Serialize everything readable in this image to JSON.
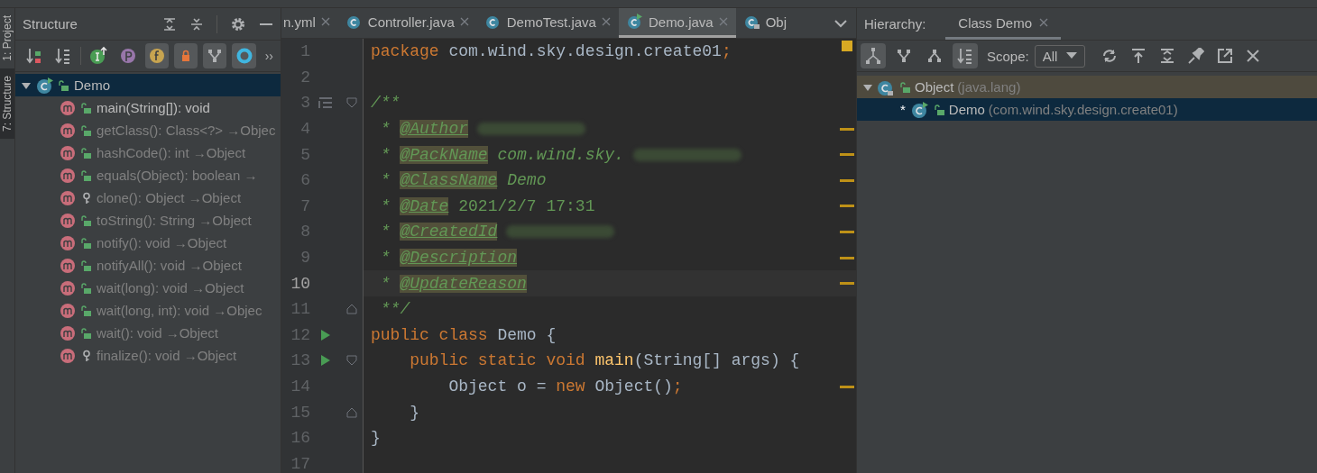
{
  "side_tabs": [
    {
      "label": "1: Project",
      "selected": false
    },
    {
      "label": "7: Structure",
      "selected": true
    }
  ],
  "structure": {
    "title": "Structure",
    "toolbar": [
      {
        "pressed": false
      },
      {
        "pressed": false
      },
      {
        "pressed": false
      },
      {
        "pressed": false
      },
      {
        "pressed": true
      },
      {
        "pressed": true
      },
      {
        "pressed": true
      },
      {
        "pressed": true
      }
    ],
    "more": "››",
    "root": {
      "label": "Demo",
      "expanded": true,
      "selected": true
    },
    "items": [
      {
        "label": "main(String[]): void",
        "kind": "public",
        "inherited": false
      },
      {
        "label": "getClass(): Class<?> →Objec",
        "kind": "public",
        "inherited": true
      },
      {
        "label": "hashCode(): int →Object",
        "kind": "public",
        "inherited": true
      },
      {
        "label": "equals(Object): boolean →",
        "kind": "public",
        "inherited": true
      },
      {
        "label": "clone(): Object →Object",
        "kind": "protected",
        "inherited": true
      },
      {
        "label": "toString(): String →Object",
        "kind": "public",
        "inherited": true
      },
      {
        "label": "notify(): void →Object",
        "kind": "public",
        "inherited": true
      },
      {
        "label": "notifyAll(): void →Object",
        "kind": "public",
        "inherited": true
      },
      {
        "label": "wait(long): void →Object",
        "kind": "public",
        "inherited": true
      },
      {
        "label": "wait(long, int): void →Objec",
        "kind": "public",
        "inherited": true
      },
      {
        "label": "wait(): void →Object",
        "kind": "public",
        "inherited": true
      },
      {
        "label": "finalize(): void →Object",
        "kind": "protected",
        "inherited": true
      }
    ]
  },
  "editor": {
    "tabs": [
      {
        "label": "n.yml",
        "kind": "file",
        "selected": false,
        "closable": true
      },
      {
        "label": "Controller.java",
        "kind": "class",
        "selected": false,
        "closable": true
      },
      {
        "label": "DemoTest.java",
        "kind": "class",
        "selected": false,
        "closable": true
      },
      {
        "label": "Demo.java",
        "kind": "runnable",
        "selected": true,
        "closable": true
      },
      {
        "label": "Obj",
        "kind": "locked",
        "selected": false,
        "closable": false
      }
    ],
    "lines": [
      {
        "n": "1",
        "tokens": [
          {
            "kind": "kw",
            "text": "package"
          },
          {
            "kind": "plain",
            "text": " com.wind.sky.design.create01"
          },
          {
            "kind": "kw",
            "text": ";"
          }
        ],
        "run": false,
        "doc_render": false,
        "fold_start": false,
        "fold_end": false,
        "warning": false,
        "current": false
      },
      {
        "n": "2",
        "run": false,
        "doc_render": false,
        "fold_start": false,
        "fold_end": false,
        "warning": false,
        "current": false
      },
      {
        "n": "3",
        "tokens": [
          {
            "kind": "doc",
            "text": "/**"
          }
        ],
        "run": false,
        "doc_render": true,
        "fold_start": true,
        "fold_end": false,
        "warning": false,
        "current": false
      },
      {
        "n": "4",
        "tokens": [
          {
            "kind": "doc",
            "text": " * "
          },
          {
            "kind": "tag",
            "text": "@Author"
          },
          {
            "kind": "redacted"
          }
        ],
        "run": false,
        "doc_render": false,
        "fold_start": false,
        "fold_end": false,
        "warning": true,
        "current": false
      },
      {
        "n": "5",
        "tokens": [
          {
            "kind": "doc",
            "text": " * "
          },
          {
            "kind": "tag",
            "text": "@PackName"
          },
          {
            "kind": "doc",
            "text": " com.wind.sky."
          },
          {
            "kind": "redacted"
          }
        ],
        "run": false,
        "doc_render": false,
        "fold_start": false,
        "fold_end": false,
        "warning": true,
        "current": false
      },
      {
        "n": "6",
        "tokens": [
          {
            "kind": "doc",
            "text": " * "
          },
          {
            "kind": "tag",
            "text": "@ClassName"
          },
          {
            "kind": "doc",
            "text": " Demo"
          }
        ],
        "run": false,
        "doc_render": false,
        "fold_start": false,
        "fold_end": false,
        "warning": true,
        "current": false
      },
      {
        "n": "7",
        "tokens": [
          {
            "kind": "doc",
            "text": " * "
          },
          {
            "kind": "tag",
            "text": "@Date"
          },
          {
            "kind": "docplain",
            "text": " 2021/2/7 17:31"
          }
        ],
        "run": false,
        "doc_render": false,
        "fold_start": false,
        "fold_end": false,
        "warning": true,
        "current": false
      },
      {
        "n": "8",
        "tokens": [
          {
            "kind": "doc",
            "text": " * "
          },
          {
            "kind": "tag",
            "text": "@CreatedId"
          },
          {
            "kind": "redacted"
          }
        ],
        "run": false,
        "doc_render": false,
        "fold_start": false,
        "fold_end": false,
        "warning": true,
        "current": false
      },
      {
        "n": "9",
        "tokens": [
          {
            "kind": "doc",
            "text": " * "
          },
          {
            "kind": "tag",
            "text": "@Description"
          }
        ],
        "run": false,
        "doc_render": false,
        "fold_start": false,
        "fold_end": false,
        "warning": true,
        "current": false
      },
      {
        "n": "10",
        "tokens": [
          {
            "kind": "doc",
            "text": " * "
          },
          {
            "kind": "tag",
            "text": "@UpdateReason"
          }
        ],
        "run": false,
        "doc_render": false,
        "fold_start": false,
        "fold_end": false,
        "warning": true,
        "current": true
      },
      {
        "n": "11",
        "tokens": [
          {
            "kind": "doc",
            "text": " **/"
          }
        ],
        "run": false,
        "doc_render": false,
        "fold_start": false,
        "fold_end": true,
        "warning": false,
        "current": false
      },
      {
        "n": "12",
        "tokens": [
          {
            "kind": "kw",
            "text": "public class"
          },
          {
            "kind": "plain",
            "text": " Demo {"
          }
        ],
        "run": true,
        "doc_render": false,
        "fold_start": false,
        "fold_end": false,
        "warning": false,
        "current": false
      },
      {
        "n": "13",
        "tokens": [
          {
            "kind": "kw",
            "text": "    public static void"
          },
          {
            "kind": "method",
            "text": " main"
          },
          {
            "kind": "plain",
            "text": "(String[] args) {"
          }
        ],
        "run": true,
        "doc_render": false,
        "fold_start": true,
        "fold_end": false,
        "warning": false,
        "current": false
      },
      {
        "n": "14",
        "tokens": [
          {
            "kind": "plain",
            "text": "        Object o = "
          },
          {
            "kind": "kw",
            "text": "new"
          },
          {
            "kind": "plain",
            "text": " Object()"
          },
          {
            "kind": "kw",
            "text": ";"
          }
        ],
        "run": false,
        "doc_render": false,
        "fold_start": false,
        "fold_end": false,
        "warning": true,
        "current": false
      },
      {
        "n": "15",
        "tokens": [
          {
            "kind": "plain",
            "text": "    }"
          }
        ],
        "run": false,
        "doc_render": false,
        "fold_start": false,
        "fold_end": true,
        "warning": false,
        "current": false
      },
      {
        "n": "16",
        "tokens": [
          {
            "kind": "plain",
            "text": "}"
          }
        ],
        "run": false,
        "doc_render": false,
        "fold_start": false,
        "fold_end": false,
        "warning": false,
        "current": false
      },
      {
        "n": "17",
        "run": false,
        "doc_render": false,
        "fold_start": false,
        "fold_end": false,
        "warning": false,
        "current": false
      }
    ]
  },
  "hierarchy": {
    "title": "Hierarchy:",
    "tab": {
      "label": "Class Demo",
      "selected": true
    },
    "toolbar": [
      {
        "pressed": true
      },
      {
        "pressed": false
      },
      {
        "pressed": false
      },
      {
        "pressed": true
      }
    ],
    "scope_label": "Scope:",
    "scope_value": "All",
    "tree": [
      {
        "name": "Object",
        "package": "(java.lang)",
        "expanded": true,
        "selected": false,
        "highlight": true,
        "locked": true,
        "children": [
          {
            "name": "Demo",
            "package": "(com.wind.sky.design.create01)",
            "mark": "*",
            "selected": true,
            "locked": false
          }
        ]
      }
    ]
  }
}
